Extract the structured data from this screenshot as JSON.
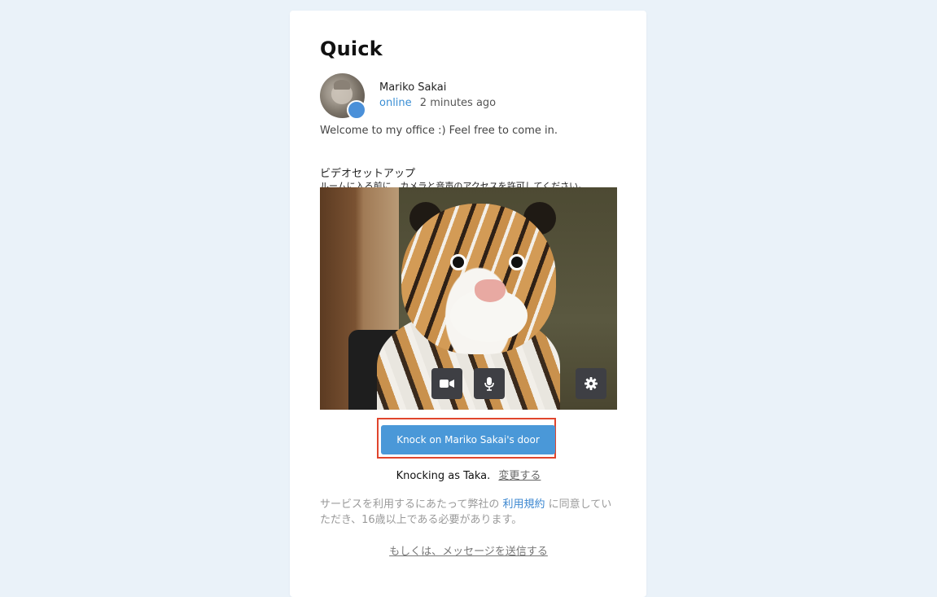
{
  "card": {
    "title": "Quick"
  },
  "host": {
    "name": "Mariko Sakai",
    "status": "online",
    "last_seen": "2 minutes ago",
    "welcome_message": "Welcome to my office :) Feel free to come in."
  },
  "video_setup": {
    "heading": "ビデオセットアップ",
    "subtext": "ルームに入る前に、カメラと音声のアクセスを許可してください。",
    "controls": {
      "camera_icon": "video-camera-icon",
      "mic_icon": "microphone-icon",
      "settings_icon": "gear-icon"
    }
  },
  "knock": {
    "button_label": "Knock on Mariko Sakai's door",
    "knocking_as": "Knocking as Taka.",
    "change_link": "変更する"
  },
  "terms": {
    "before": "サービスを利用するにあたって弊社の",
    "link": "利用規約",
    "after": "に同意していただき、16歳以上である必要があります。"
  },
  "alt_action": {
    "label": "もしくは、メッセージを送信する"
  },
  "colors": {
    "background": "#eaf2f9",
    "accent": "#4a98d8",
    "highlight_outline": "#e0452d",
    "status_dot": "#4a90d9"
  }
}
